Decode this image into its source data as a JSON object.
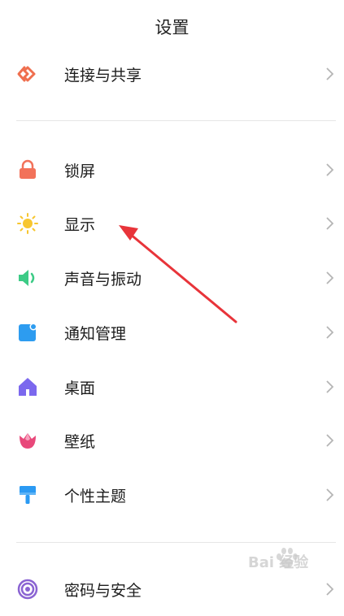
{
  "header": {
    "title": "设置"
  },
  "items": [
    {
      "label": "连接与共享",
      "icon": "connection-share-icon",
      "color": "#ef6f4f"
    },
    {
      "label": "锁屏",
      "icon": "lock-icon",
      "color": "#f2725a"
    },
    {
      "label": "显示",
      "icon": "sun-icon",
      "color": "#f7c62f"
    },
    {
      "label": "声音与振动",
      "icon": "speaker-icon",
      "color": "#3dcb86"
    },
    {
      "label": "通知管理",
      "icon": "notification-icon",
      "color": "#2d9cf0"
    },
    {
      "label": "桌面",
      "icon": "home-icon",
      "color": "#7b68ee"
    },
    {
      "label": "壁纸",
      "icon": "tulip-icon",
      "color": "#e8487a"
    },
    {
      "label": "个性主题",
      "icon": "brush-icon",
      "color": "#2b9af3"
    },
    {
      "label": "密码与安全",
      "icon": "fingerprint-icon",
      "color": "#8a63d2"
    }
  ],
  "annotation": {
    "color": "#e8343a"
  },
  "watermark": {
    "text": "Bai 经验"
  }
}
